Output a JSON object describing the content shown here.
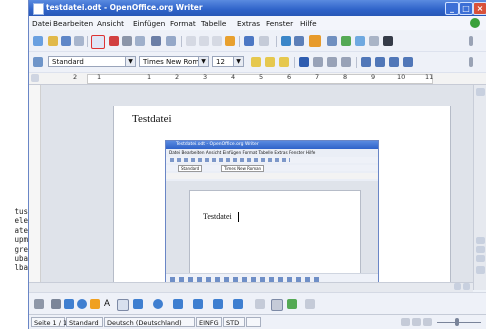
{
  "background_terminal": {
    "lines": [
      "tus",
      "ele",
      "ate",
      "upm",
      "gre",
      "uba",
      "lba"
    ]
  },
  "window": {
    "title": "testdatei.odt - OpenOffice.org Writer",
    "controls": {
      "minimize": "_",
      "maximize": "□",
      "close": "×"
    }
  },
  "menubar": {
    "items": [
      "Datei",
      "Bearbeiten",
      "Ansicht",
      "Einfügen",
      "Format",
      "Tabelle",
      "Extras",
      "Fenster",
      "Hilfe"
    ]
  },
  "formatting": {
    "style": "Standard",
    "font": "Times New Roman",
    "size": "12"
  },
  "ruler": {
    "numbers": [
      "2",
      "1",
      "1",
      "2",
      "3",
      "4",
      "5",
      "6",
      "7",
      "8",
      "9",
      "10",
      "11"
    ]
  },
  "document": {
    "heading": "Testdatei"
  },
  "nested_screenshot": {
    "title": "Testdatei.odt - OpenOffice.org Writer",
    "menu": "Datei Bearbeiten Ansicht Einfügen Format Tabelle Extras Fenster Hilfe",
    "style": "Standard",
    "font": "Times New Roman",
    "heading": "Testdatei"
  },
  "drawing_toolbar": {
    "text_tool": "A"
  },
  "statusbar": {
    "page": "Seite 1 / 1",
    "style": "Standard",
    "language": "Deutsch (Deutschland)",
    "insert_mode": "EINFG",
    "selection_mode": "STD"
  },
  "colors": {
    "titlebar": "#2f63c9",
    "workspace": "#dfe3ea",
    "page": "#ffffff"
  }
}
